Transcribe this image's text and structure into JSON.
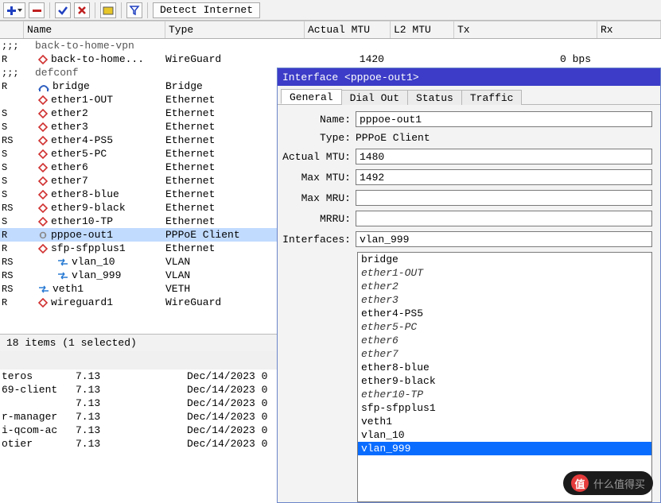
{
  "toolbar": {
    "detect_label": "Detect Internet"
  },
  "columns": {
    "name": "Name",
    "type": "Type",
    "actual_mtu": "Actual MTU",
    "l2_mtu": "L2 MTU",
    "tx": "Tx",
    "rx": "Rx"
  },
  "groups": [
    {
      "flags": ";;;",
      "label": "back-to-home-vpn"
    },
    {
      "flags": ";;;",
      "label": "defconf"
    }
  ],
  "rows": [
    {
      "flags": "R",
      "indent": 1,
      "icon": "diamond",
      "name": "back-to-home...",
      "type": "WireGuard",
      "actual_mtu": "1420",
      "tx": "0 bps",
      "group": 0
    },
    {
      "flags": "R",
      "indent": 1,
      "icon": "bridge",
      "name": "bridge",
      "type": "Bridge",
      "group": 1
    },
    {
      "flags": "",
      "indent": 1,
      "icon": "diamond",
      "name": "ether1-OUT",
      "type": "Ethernet",
      "group": 1
    },
    {
      "flags": "S",
      "indent": 1,
      "icon": "diamond",
      "name": "ether2",
      "type": "Ethernet",
      "group": 1
    },
    {
      "flags": "S",
      "indent": 1,
      "icon": "diamond",
      "name": "ether3",
      "type": "Ethernet",
      "group": 1
    },
    {
      "flags": "RS",
      "indent": 1,
      "icon": "diamond",
      "name": "ether4-PS5",
      "type": "Ethernet",
      "group": 1
    },
    {
      "flags": "S",
      "indent": 1,
      "icon": "diamond",
      "name": "ether5-PC",
      "type": "Ethernet",
      "group": 1
    },
    {
      "flags": "S",
      "indent": 1,
      "icon": "diamond",
      "name": "ether6",
      "type": "Ethernet",
      "group": 1
    },
    {
      "flags": "S",
      "indent": 1,
      "icon": "diamond",
      "name": "ether7",
      "type": "Ethernet",
      "group": 1
    },
    {
      "flags": "S",
      "indent": 1,
      "icon": "diamond",
      "name": "ether8-blue",
      "type": "Ethernet",
      "group": 1
    },
    {
      "flags": "RS",
      "indent": 1,
      "icon": "diamond",
      "name": "ether9-black",
      "type": "Ethernet",
      "group": 1
    },
    {
      "flags": "S",
      "indent": 1,
      "icon": "diamond",
      "name": "ether10-TP",
      "type": "Ethernet",
      "group": 1
    },
    {
      "flags": "R",
      "indent": 1,
      "icon": "dot",
      "name": "pppoe-out1",
      "type": "PPPoE Client",
      "selected": true,
      "group": 1
    },
    {
      "flags": "R",
      "indent": 1,
      "icon": "diamond",
      "name": "sfp-sfpplus1",
      "type": "Ethernet",
      "group": 1
    },
    {
      "flags": "RS",
      "indent": 2,
      "icon": "arrows",
      "name": "vlan_10",
      "type": "VLAN",
      "group": 1
    },
    {
      "flags": "RS",
      "indent": 2,
      "icon": "arrows",
      "name": "vlan_999",
      "type": "VLAN",
      "group": 1
    },
    {
      "flags": "RS",
      "indent": 1,
      "icon": "arrows",
      "name": "veth1",
      "type": "VETH",
      "group": 1
    },
    {
      "flags": "R",
      "indent": 1,
      "icon": "diamond",
      "name": "wireguard1",
      "type": "WireGuard",
      "group": 1
    }
  ],
  "status": "18 items (1 selected)",
  "packages": [
    {
      "name": "teros",
      "ver": "7.13",
      "date": "Dec/14/2023 0"
    },
    {
      "name": "69-client",
      "ver": "7.13",
      "date": "Dec/14/2023 0"
    },
    {
      "name": "",
      "ver": "7.13",
      "date": "Dec/14/2023 0"
    },
    {
      "name": "r-manager",
      "ver": "7.13",
      "date": "Dec/14/2023 0"
    },
    {
      "name": "i-qcom-ac",
      "ver": "7.13",
      "date": "Dec/14/2023 0"
    },
    {
      "name": "otier",
      "ver": "7.13",
      "date": "Dec/14/2023 0"
    }
  ],
  "property_window": {
    "title": "Interface <pppoe-out1>",
    "tabs": [
      "General",
      "Dial Out",
      "Status",
      "Traffic"
    ],
    "active_tab": 0,
    "labels": {
      "name": "Name:",
      "type": "Type:",
      "actual_mtu": "Actual MTU:",
      "max_mtu": "Max MTU:",
      "max_mru": "Max MRU:",
      "mrru": "MRRU:",
      "interfaces": "Interfaces:"
    },
    "values": {
      "name": "pppoe-out1",
      "type": "PPPoE Client",
      "actual_mtu": "1480",
      "max_mtu": "1492",
      "max_mru": "",
      "mrru": "",
      "iface_current": "vlan_999"
    },
    "iface_options": [
      {
        "label": "bridge",
        "italic": false
      },
      {
        "label": "ether1-OUT",
        "italic": true
      },
      {
        "label": "ether2",
        "italic": true
      },
      {
        "label": "ether3",
        "italic": true
      },
      {
        "label": "ether4-PS5",
        "italic": false
      },
      {
        "label": "ether5-PC",
        "italic": true
      },
      {
        "label": "ether6",
        "italic": true
      },
      {
        "label": "ether7",
        "italic": true
      },
      {
        "label": "ether8-blue",
        "italic": false
      },
      {
        "label": "ether9-black",
        "italic": false
      },
      {
        "label": "ether10-TP",
        "italic": true
      },
      {
        "label": "sfp-sfpplus1",
        "italic": false
      },
      {
        "label": "veth1",
        "italic": false
      },
      {
        "label": "vlan_10",
        "italic": false
      },
      {
        "label": "vlan_999",
        "italic": false,
        "selected": true
      }
    ]
  },
  "watermark": {
    "badge": "值",
    "text": "什么值得买"
  }
}
